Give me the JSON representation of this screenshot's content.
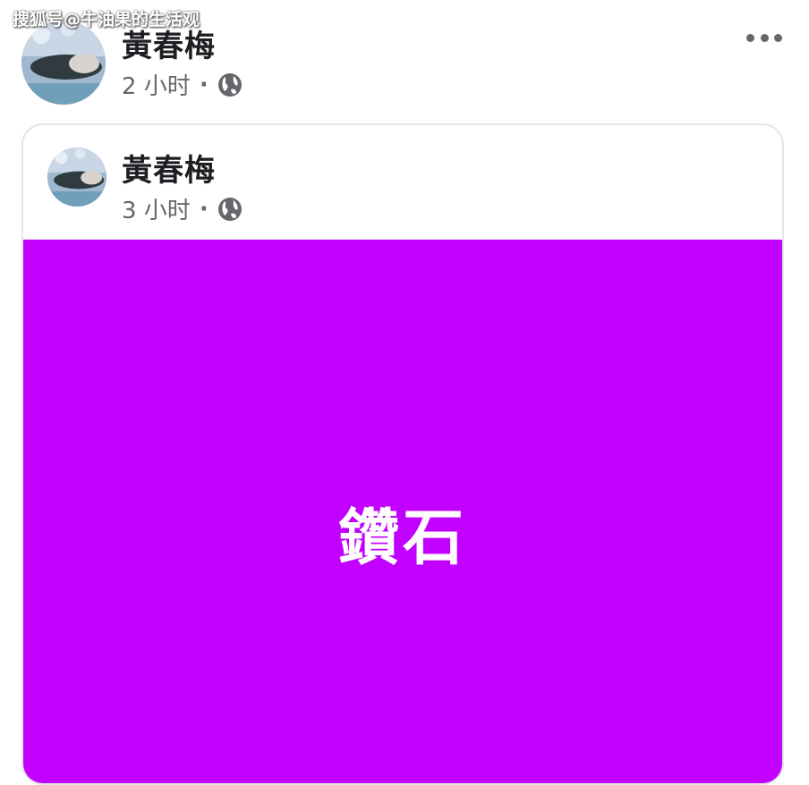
{
  "watermark": "搜狐号@牛油果的生活观",
  "post": {
    "author": "黃春梅",
    "time": "2 小时",
    "separator": "·",
    "privacy_icon": "globe-icon",
    "menu_icon": "more-options-icon"
  },
  "shared_post": {
    "author": "黃春梅",
    "time": "3 小时",
    "separator": "·",
    "privacy_icon": "globe-icon",
    "background_color": "#c100ff",
    "status_text": "鑽石"
  }
}
